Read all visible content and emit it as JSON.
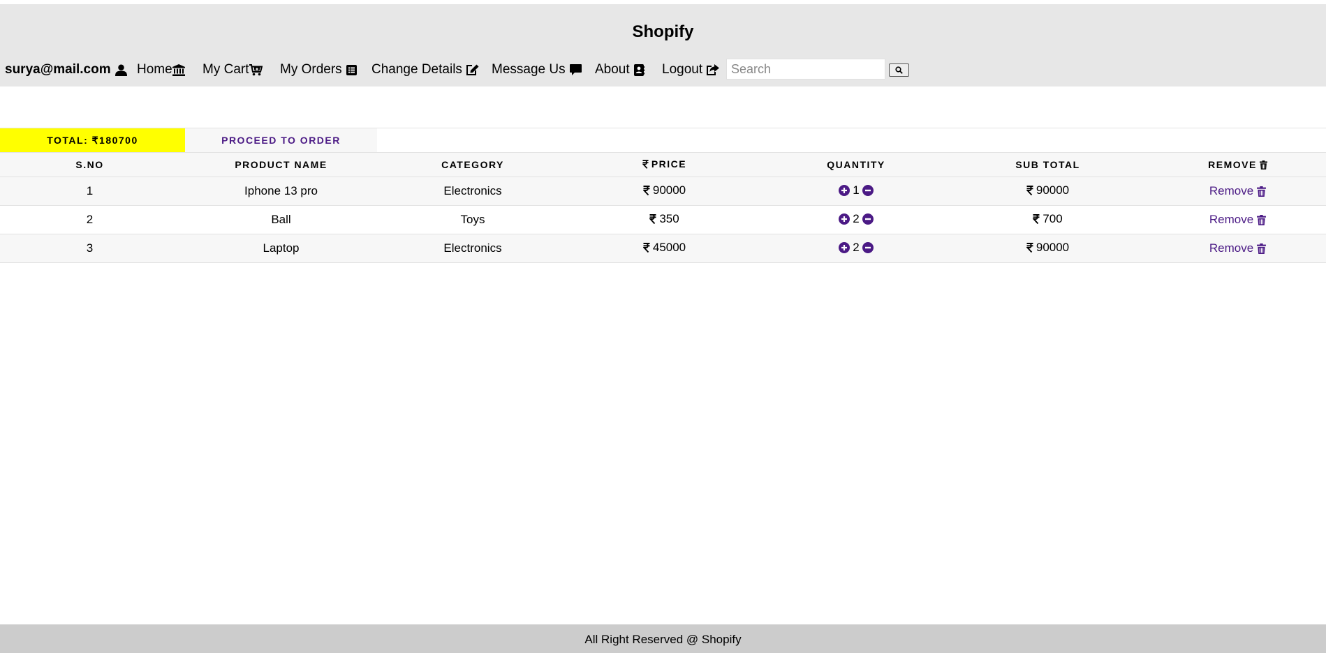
{
  "brand": "Shopify",
  "nav": {
    "user": "surya@mail.com",
    "home": "Home",
    "cart": "My Cart",
    "orders": "My Orders",
    "change_details": "Change Details",
    "message": "Message Us",
    "about": "About",
    "logout": "Logout"
  },
  "search": {
    "placeholder": "Search",
    "value": ""
  },
  "summary": {
    "total_label": "TOTAL: ₹180700",
    "proceed_label": "PROCEED TO ORDER"
  },
  "table": {
    "headers": {
      "sno": "S.NO",
      "product": "PRODUCT NAME",
      "category": "CATEGORY",
      "price": "PRICE",
      "quantity": "QUANTITY",
      "subtotal": "SUB TOTAL",
      "remove": "REMOVE"
    },
    "rows": [
      {
        "sno": "1",
        "product": "Iphone 13 pro",
        "category": "Electronics",
        "price": "90000",
        "quantity": "1",
        "subtotal": "90000",
        "remove": "Remove"
      },
      {
        "sno": "2",
        "product": "Ball",
        "category": "Toys",
        "price": "350",
        "quantity": "2",
        "subtotal": "700",
        "remove": "Remove"
      },
      {
        "sno": "3",
        "product": "Laptop",
        "category": "Electronics",
        "price": "45000",
        "quantity": "2",
        "subtotal": "90000",
        "remove": "Remove"
      }
    ]
  },
  "footer": "All Right Reserved @ Shopify",
  "icons": [
    "user-icon",
    "bank-icon",
    "cart-plus-icon",
    "list-icon",
    "edit-icon",
    "comment-icon",
    "address-book-icon",
    "share-icon",
    "search-icon",
    "rupee-icon",
    "trash-icon",
    "plus-circle-icon",
    "minus-circle-icon"
  ],
  "colors": {
    "header_bg": "#e7e7e7",
    "accent": "#4b1a85",
    "total_bg": "#ffff00",
    "footer_bg": "#cccccc"
  }
}
